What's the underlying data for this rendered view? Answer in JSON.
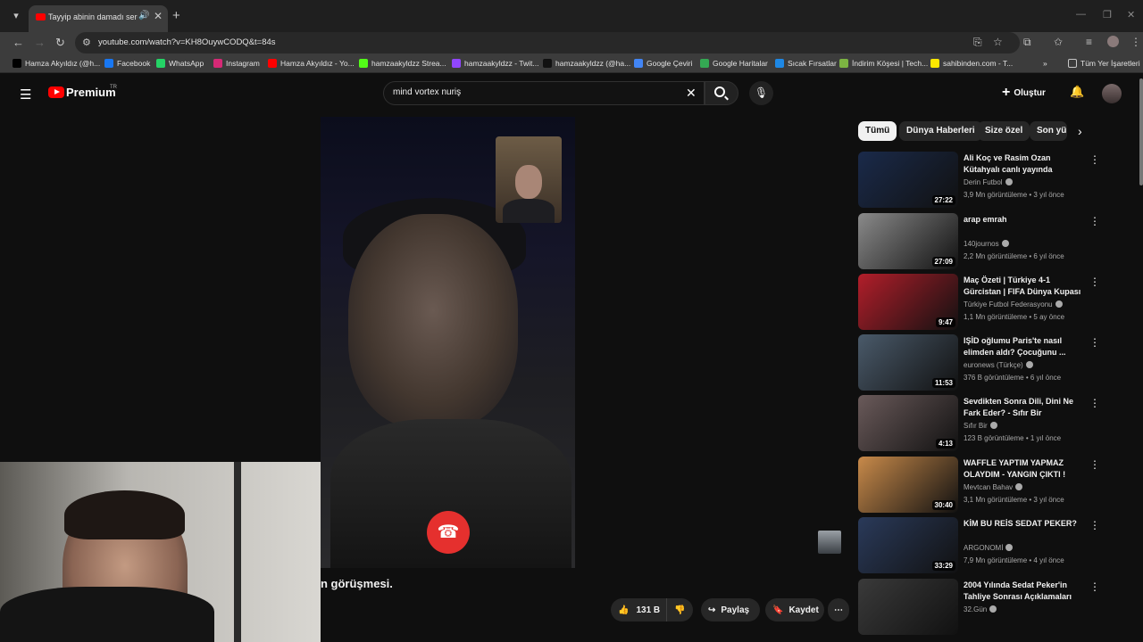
{
  "browser": {
    "tab_title": "Tayyip abinin damadı serdar",
    "url": "youtube.com/watch?v=KH8OuywCODQ&t=84s",
    "bookmarks": [
      {
        "label": "Hamza Akyıldız (@h...",
        "icon": "x-icon",
        "color": "#000000"
      },
      {
        "label": "Facebook",
        "icon": "facebook-icon",
        "color": "#1877f2"
      },
      {
        "label": "WhatsApp",
        "icon": "whatsapp-icon",
        "color": "#25d366"
      },
      {
        "label": "Instagram",
        "icon": "instagram-icon",
        "color": "#d62976"
      },
      {
        "label": "Hamza Akyıldız - Yo...",
        "icon": "youtube-icon",
        "color": "#ff0000"
      },
      {
        "label": "hamzaakyldzz Strea...",
        "icon": "kick-icon",
        "color": "#53fc18"
      },
      {
        "label": "hamzaakyldzz - Twit...",
        "icon": "twitch-icon",
        "color": "#9146ff"
      },
      {
        "label": "hamzaakyldzz (@ha...",
        "icon": "tiktok-icon",
        "color": "#111111"
      },
      {
        "label": "Google Çeviri",
        "icon": "translate-icon",
        "color": "#4285f4"
      },
      {
        "label": "Google Haritalar",
        "icon": "maps-icon",
        "color": "#34a853"
      },
      {
        "label": "Sıcak Fırsatlar",
        "icon": "deals-icon",
        "color": "#1e88e5"
      },
      {
        "label": "İndirim Köşesi | Tech...",
        "icon": "discount-icon",
        "color": "#7cb342"
      },
      {
        "label": "sahibinden.com - T...",
        "icon": "sahibinden-icon",
        "color": "#ffe800"
      }
    ],
    "all_bookmarks": "Tüm Yer İşaretleri"
  },
  "youtube": {
    "logo_text": "Premium",
    "region": "TR",
    "search_value": "mind vortex nuriş",
    "create_label": "Oluştur"
  },
  "video": {
    "title": "n görüşmesi.",
    "likes": "131 B",
    "share_label": "Paylaş",
    "save_label": "Kaydet"
  },
  "chips": [
    "Tümü",
    "Dünya Haberleri",
    "Size özel",
    "Son yük"
  ],
  "recommendations": [
    {
      "title": "Ali Koç ve Rasim Ozan Kütahyalı canlı yayında birbirine girdi! ...",
      "channel": "Derin Futbol",
      "views": "3,9 Mn görüntüleme",
      "age": "3 yıl önce",
      "duration": "27:22",
      "thumb_color": "#1a2a4a"
    },
    {
      "title": "arap emrah",
      "channel": "140journos",
      "views": "2,2 Mn görüntüleme",
      "age": "6 yıl önce",
      "duration": "27:09",
      "thumb_color": "#8a8a8a"
    },
    {
      "title": "Maç Özeti | Türkiye 4-1 Gürcistan | FIFA Dünya Kupası ...",
      "channel": "Türkiye Futbol Federasyonu",
      "views": "1,1 Mn görüntüleme",
      "age": "5 ay önce",
      "duration": "9:47",
      "thumb_color": "#b21e2a"
    },
    {
      "title": "IŞİD oğlumu Paris'te nasıl elimden aldı? Çocuğunu ...",
      "channel": "euronews (Türkçe)",
      "views": "376 B görüntüleme",
      "age": "6 yıl önce",
      "duration": "11:53",
      "thumb_color": "#4a5a6a"
    },
    {
      "title": "Sevdikten Sonra Dili, Dini Ne Fark Eder? - Sıfır Bir",
      "channel": "Sıfır Bir",
      "views": "123 B görüntüleme",
      "age": "1 yıl önce",
      "duration": "4:13",
      "thumb_color": "#6a5a5a"
    },
    {
      "title": "WAFFLE YAPTIM YAPMAZ OLAYDIM - YANGIN ÇIKTI !",
      "channel": "Mevtcan Bahav",
      "views": "3,1 Mn görüntüleme",
      "age": "3 yıl önce",
      "duration": "30:40",
      "thumb_color": "#c88a4a"
    },
    {
      "title": "KİM BU REİS SEDAT PEKER?",
      "channel": "ARGONOMİ",
      "views": "7,9 Mn görüntüleme",
      "age": "4 yıl önce",
      "duration": "33:29",
      "thumb_color": "#2a3a5a"
    },
    {
      "title": "2004 Yılında Sedat Peker'in Tahliye Sonrası Açıklamaları",
      "channel": "32.Gün",
      "views": "",
      "age": "",
      "duration": "",
      "thumb_color": "#3a3a3a"
    }
  ]
}
